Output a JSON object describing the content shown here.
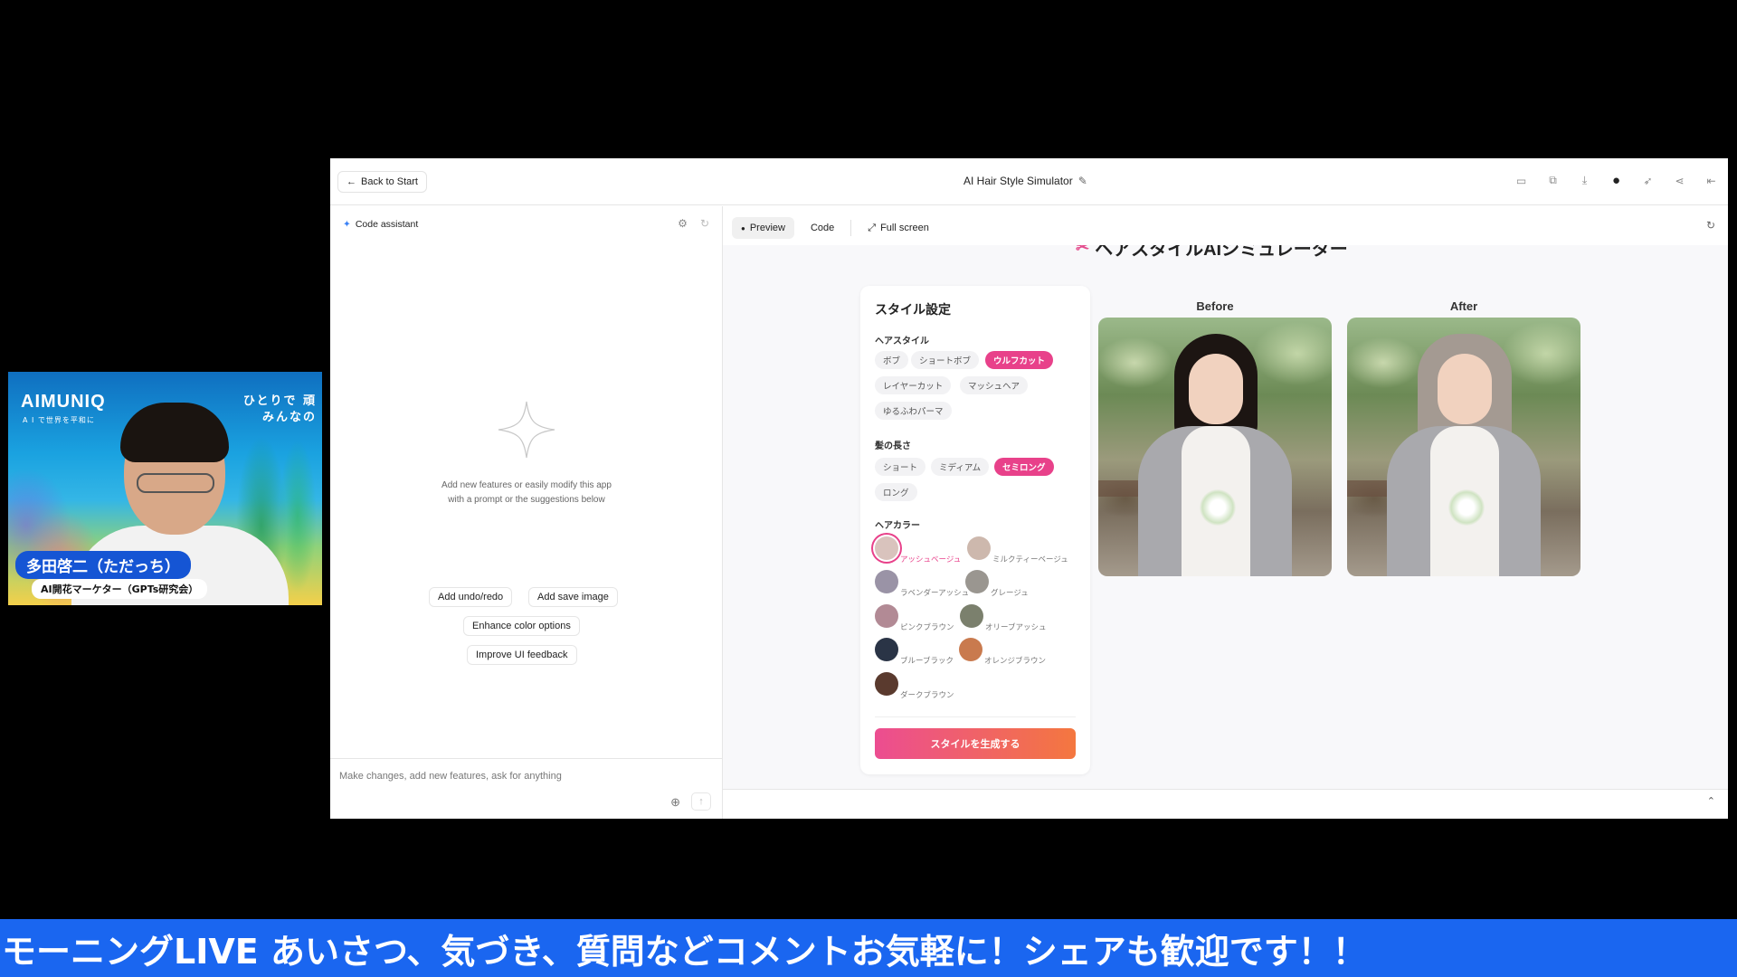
{
  "webcam": {
    "logo": "AIMUNIQ",
    "logo_sub": "A I で世界を平和に",
    "tagline_1": "ひとりで 頑",
    "tagline_2": "みんなの",
    "name": "多田啓二（ただっち）",
    "title": "AI開花マーケター（GPTs研究会）"
  },
  "topbar": {
    "back_label": "Back to Start",
    "app_title": "AI Hair Style Simulator",
    "icons": [
      "save-icon",
      "screenshot-icon",
      "download-icon",
      "github-icon",
      "deploy-icon",
      "share-icon",
      "collapse-icon"
    ]
  },
  "assistant": {
    "header": "Code assistant",
    "empty_text": "Add new features or easily modify this app with a prompt or the suggestions below",
    "suggestions": [
      "Add undo/redo",
      "Add save image",
      "Enhance color options",
      "Improve UI feedback"
    ],
    "input_placeholder": "Make changes, add new features, ask for anything"
  },
  "preview_tabs": {
    "preview": "Preview",
    "code": "Code",
    "fullscreen": "Full screen"
  },
  "app": {
    "heading": "ヘアスタイルAIシミュレーター",
    "card_title": "スタイル設定",
    "hairstyle_label": "ヘアスタイル",
    "hairstyles": [
      "ボブ",
      "ショートボブ",
      "ウルフカット",
      "レイヤーカット",
      "マッシュヘア",
      "ゆるふわパーマ"
    ],
    "selected_hairstyle": "ウルフカット",
    "length_label": "髪の長さ",
    "lengths": [
      "ショート",
      "ミディアム",
      "セミロング",
      "ロング"
    ],
    "selected_length": "セミロング",
    "color_label": "ヘアカラー",
    "colors": [
      {
        "name": "アッシュベージュ",
        "hex": "#d9c3bd"
      },
      {
        "name": "ミルクティーベージュ",
        "hex": "#cdb8ad"
      },
      {
        "name": "ラベンダーアッシュ",
        "hex": "#9a93a6"
      },
      {
        "name": "グレージュ",
        "hex": "#9a9690"
      },
      {
        "name": "ピンクブラウン",
        "hex": "#b28a95"
      },
      {
        "name": "オリーブアッシュ",
        "hex": "#7b806d"
      },
      {
        "name": "ブルーブラック",
        "hex": "#2a3446"
      },
      {
        "name": "オレンジブラウン",
        "hex": "#c97a4e"
      },
      {
        "name": "ダークブラウン",
        "hex": "#5a3a2e"
      }
    ],
    "selected_color": "アッシュベージュ",
    "generate_label": "スタイルを生成する",
    "before_label": "Before",
    "after_label": "After"
  },
  "ticker": "モーニングLIVE あいさつ、気づき、質問などコメントお気軽に！シェアも歓迎です！！"
}
